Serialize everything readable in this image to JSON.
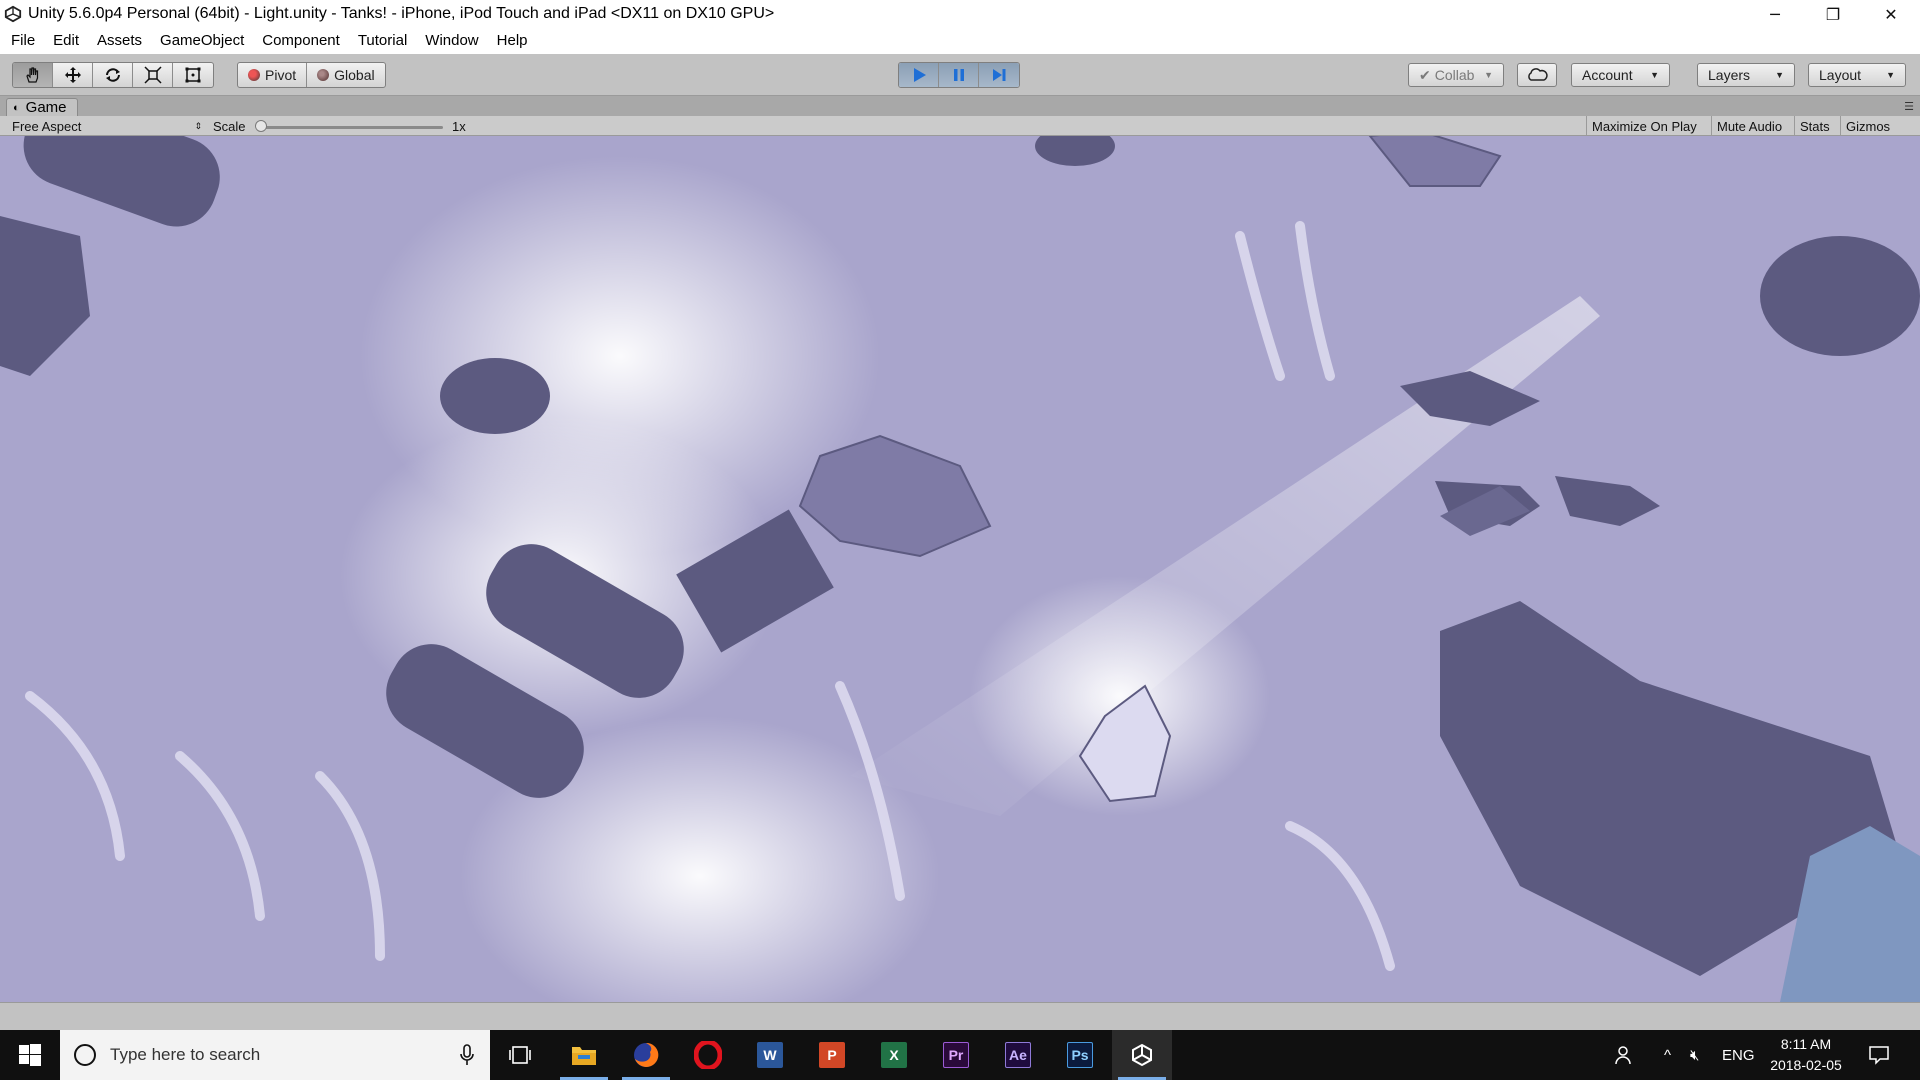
{
  "window": {
    "title": "Unity 5.6.0p4 Personal (64bit) - Light.unity - Tanks! - iPhone, iPod Touch and iPad <DX11 on DX10 GPU>",
    "minimize": "─",
    "restore": "❐",
    "close": "✕"
  },
  "menu": [
    "File",
    "Edit",
    "Assets",
    "GameObject",
    "Component",
    "Tutorial",
    "Window",
    "Help"
  ],
  "toolbar": {
    "tools": [
      "hand-tool",
      "move-tool",
      "rotate-tool",
      "scale-tool",
      "rect-tool"
    ],
    "active_tool": "hand-tool",
    "pivot_label": "Pivot",
    "global_label": "Global",
    "play_controls": [
      "play",
      "pause",
      "step"
    ],
    "play_state": "playing",
    "collab_label": "Collab",
    "account_label": "Account",
    "layers_label": "Layers",
    "layout_label": "Layout"
  },
  "game_panel": {
    "tab_label": "Game",
    "aspect": "Free Aspect",
    "scale_label": "Scale",
    "scale_value": "1x",
    "maximize_on_play": "Maximize On Play",
    "mute_audio": "Mute Audio",
    "stats": "Stats",
    "gizmos": "Gizmos"
  },
  "taskbar": {
    "search_placeholder": "Type here to search",
    "apps": [
      {
        "name": "task-view",
        "label": ""
      },
      {
        "name": "file-explorer",
        "label": ""
      },
      {
        "name": "firefox",
        "label": ""
      },
      {
        "name": "opera",
        "label": "O",
        "color": "#e0141e"
      },
      {
        "name": "word",
        "label": "W",
        "color": "#2b579a"
      },
      {
        "name": "powerpoint",
        "label": "P",
        "color": "#d24726"
      },
      {
        "name": "excel",
        "label": "X",
        "color": "#217346"
      },
      {
        "name": "premiere",
        "label": "Pr",
        "color": "#2a0a3a"
      },
      {
        "name": "after-effects",
        "label": "Ae",
        "color": "#1f0b3e"
      },
      {
        "name": "photoshop",
        "label": "Ps",
        "color": "#0b1b3e"
      },
      {
        "name": "unity",
        "label": ""
      }
    ],
    "language": "ENG",
    "time": "8:11 AM",
    "date": "2018-02-05"
  },
  "colors": {
    "ground": "#a9a5cc",
    "shadow": "#5c5a80",
    "light": "#f4f2ff",
    "play_active": "#1f6fd6"
  }
}
